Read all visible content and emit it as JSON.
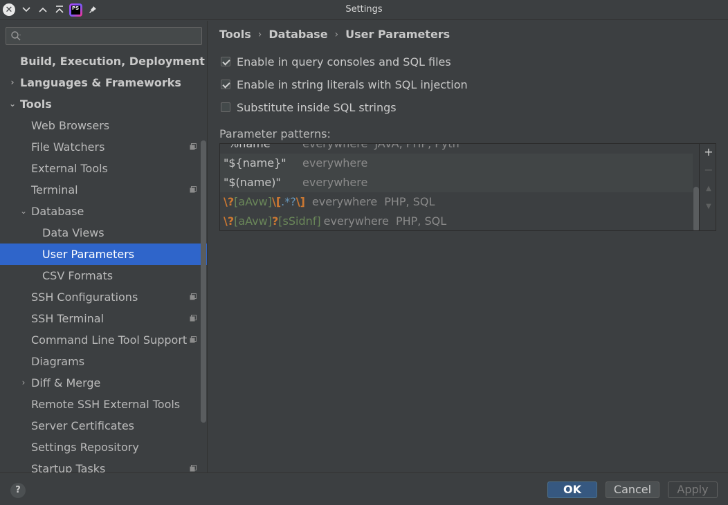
{
  "window": {
    "title": "Settings"
  },
  "titlebar": {
    "logo_text": "PS"
  },
  "search": {
    "placeholder": ""
  },
  "sidebar": {
    "items": [
      {
        "label": "Build, Execution, Deployment",
        "level": 0,
        "bold": true,
        "arrow": "",
        "proj": false
      },
      {
        "label": "Languages & Frameworks",
        "level": 0,
        "bold": true,
        "arrow": "›",
        "proj": false
      },
      {
        "label": "Tools",
        "level": 0,
        "bold": true,
        "arrow": "⌄",
        "proj": false
      },
      {
        "label": "Web Browsers",
        "level": 1,
        "arrow": "",
        "proj": false
      },
      {
        "label": "File Watchers",
        "level": 1,
        "arrow": "",
        "proj": true
      },
      {
        "label": "External Tools",
        "level": 1,
        "arrow": "",
        "proj": false
      },
      {
        "label": "Terminal",
        "level": 1,
        "arrow": "",
        "proj": true
      },
      {
        "label": "Database",
        "level": 1,
        "arrow": "⌄",
        "proj": false
      },
      {
        "label": "Data Views",
        "level": 2,
        "arrow": "",
        "proj": false
      },
      {
        "label": "User Parameters",
        "level": 2,
        "arrow": "",
        "proj": false,
        "selected": true
      },
      {
        "label": "CSV Formats",
        "level": 2,
        "arrow": "",
        "proj": false
      },
      {
        "label": "SSH Configurations",
        "level": 1,
        "arrow": "",
        "proj": true
      },
      {
        "label": "SSH Terminal",
        "level": 1,
        "arrow": "",
        "proj": true
      },
      {
        "label": "Command Line Tool Support",
        "level": 1,
        "arrow": "",
        "proj": true
      },
      {
        "label": "Diagrams",
        "level": 1,
        "arrow": "",
        "proj": false
      },
      {
        "label": "Diff & Merge",
        "level": 1,
        "arrow": "›",
        "proj": false
      },
      {
        "label": "Remote SSH External Tools",
        "level": 1,
        "arrow": "",
        "proj": false
      },
      {
        "label": "Server Certificates",
        "level": 1,
        "arrow": "",
        "proj": false
      },
      {
        "label": "Settings Repository",
        "level": 1,
        "arrow": "",
        "proj": false
      },
      {
        "label": "Startup Tasks",
        "level": 1,
        "arrow": "",
        "proj": true
      }
    ]
  },
  "breadcrumb": {
    "parts": [
      "Tools",
      "Database",
      "User Parameters"
    ]
  },
  "options": [
    {
      "label": "Enable in query consoles and SQL files",
      "checked": true
    },
    {
      "label": "Enable in string literals with SQL injection",
      "checked": true
    },
    {
      "label": "Substitute inside SQL strings",
      "checked": false
    }
  ],
  "patterns": {
    "label": "Parameter patterns:",
    "rows": [
      {
        "pattern_parts": [
          {
            "t": "%name",
            "c": "rx-plain"
          }
        ],
        "scope": "everywhere",
        "langs": "JAVA, PHP, Pyth"
      },
      {
        "pattern_parts": [
          {
            "t": "\"${name}\"",
            "c": "rx-plain"
          }
        ],
        "scope": "everywhere",
        "langs": ""
      },
      {
        "pattern_parts": [
          {
            "t": "\"$(name)\"",
            "c": "rx-plain"
          }
        ],
        "scope": "everywhere",
        "langs": ""
      },
      {
        "pattern_parts": [
          {
            "t": "\\?",
            "c": "rx-esc"
          },
          {
            "t": "[aAvw]",
            "c": "rx-cls"
          },
          {
            "t": "\\[",
            "c": "rx-esc"
          },
          {
            "t": ".*?",
            "c": "rx-meta"
          },
          {
            "t": "\\]",
            "c": "rx-esc"
          }
        ],
        "scope": "everywhere",
        "langs": "PHP, SQL"
      },
      {
        "pattern_parts": [
          {
            "t": "\\?",
            "c": "rx-esc"
          },
          {
            "t": "[aAvw]",
            "c": "rx-cls"
          },
          {
            "t": "?",
            "c": "rx-esc"
          },
          {
            "t": "[sSidnf]",
            "c": "rx-cls"
          }
        ],
        "scope": "everywhere",
        "langs": "PHP, SQL"
      }
    ],
    "toolbar": {
      "add": "+",
      "remove": "−",
      "up": "▲",
      "down": "▼"
    }
  },
  "footer": {
    "help": "?",
    "ok": "OK",
    "cancel": "Cancel",
    "apply": "Apply"
  },
  "colors": {
    "selection": "#2f65ca",
    "ok_button": "#365880",
    "background": "#3c3f41"
  }
}
